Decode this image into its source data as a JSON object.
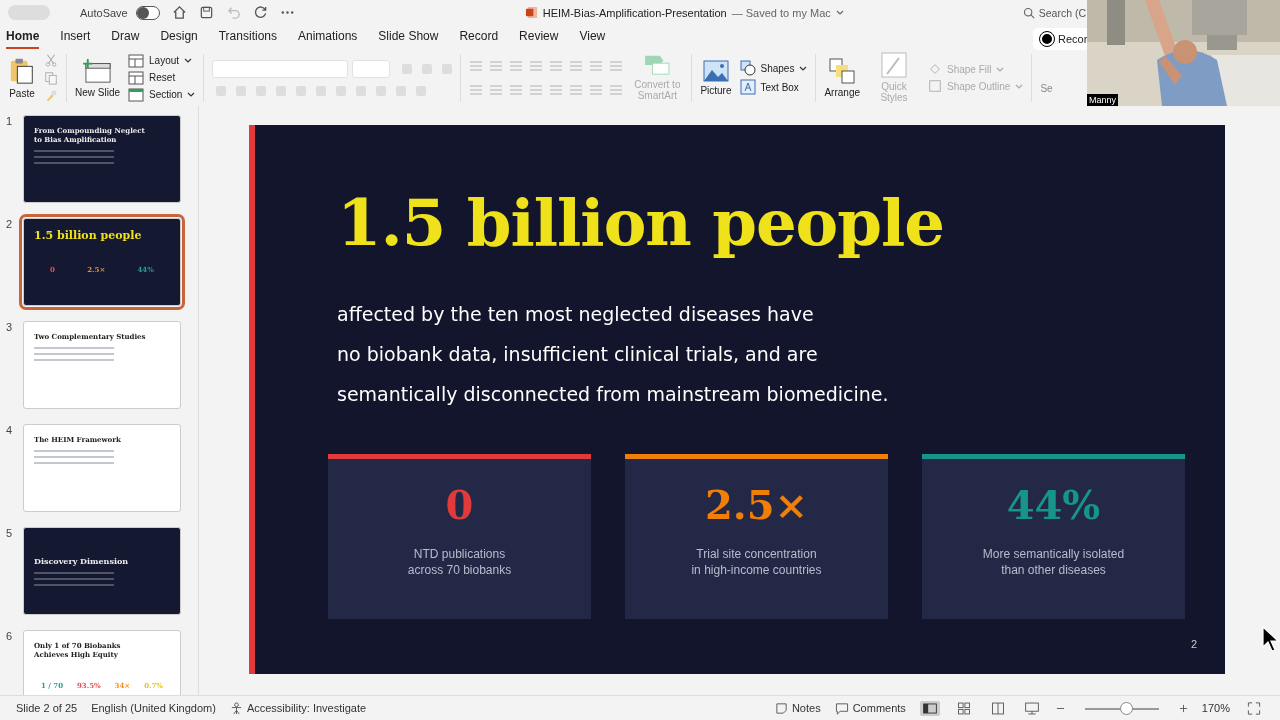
{
  "titlebar": {
    "autosave_label": "AutoSave",
    "autosave_on": false,
    "doc_title": "HEIM-Bias-Amplification-Presentation",
    "doc_status": "— Saved to my Mac",
    "search_placeholder": "Search (C"
  },
  "tabs": [
    {
      "label": "Home",
      "selected": true
    },
    {
      "label": "Insert",
      "selected": false
    },
    {
      "label": "Draw",
      "selected": false
    },
    {
      "label": "Design",
      "selected": false
    },
    {
      "label": "Transitions",
      "selected": false
    },
    {
      "label": "Animations",
      "selected": false
    },
    {
      "label": "Slide Show",
      "selected": false
    },
    {
      "label": "Record",
      "selected": false
    },
    {
      "label": "Review",
      "selected": false
    },
    {
      "label": "View",
      "selected": false
    }
  ],
  "record_button": "Recor",
  "ribbon": {
    "paste": "Paste",
    "new_slide": "New Slide",
    "slide_items": [
      "Layout",
      "Reset",
      "Section"
    ],
    "smartart": {
      "label": "Convert to SmartArt",
      "disabled": true
    },
    "picture": "Picture",
    "shapes": "Shapes",
    "text_box": "Text Box",
    "arrange": "Arrange",
    "quick_styles": {
      "label": "Quick Styles",
      "disabled": true
    },
    "shape_fill": {
      "label": "Shape Fill",
      "disabled": true
    },
    "shape_outline": {
      "label": "Shape Outline",
      "disabled": true
    },
    "cut_label": "Se"
  },
  "webcam": {
    "kind": "picture",
    "name": "Manny"
  },
  "thumbnails": [
    {
      "number": "1",
      "selected": false,
      "kind": "dark",
      "title": "From Compounding Neglect to Bias Amplification"
    },
    {
      "number": "2",
      "selected": true,
      "kind": "dark",
      "title": "1.5 billion people",
      "stats": [
        "0",
        "2.5×",
        "44%"
      ]
    },
    {
      "number": "3",
      "selected": false,
      "kind": "light",
      "title": "Two Complementary Studies"
    },
    {
      "number": "4",
      "selected": false,
      "kind": "light",
      "title": "The HEIM Framework"
    },
    {
      "number": "5",
      "selected": false,
      "kind": "dark",
      "title": "Discovery Dimension"
    },
    {
      "number": "6",
      "selected": false,
      "kind": "light",
      "title": "Only 1 of 70 Biobanks Achieves High Equity",
      "stats": [
        "1 / 70",
        "93.5%",
        "34×",
        "0.7%"
      ]
    }
  ],
  "slide": {
    "title": "1.5 billion people",
    "body_lines": [
      "affected by the ten most neglected diseases have",
      "no biobank data, insufficient clinical trials, and are",
      "semantically disconnected from mainstream biomedicine."
    ],
    "stats": [
      {
        "value": "0",
        "caption": [
          "NTD publications",
          "across 70 biobanks"
        ],
        "color": "#e03a3a"
      },
      {
        "value": "2.5×",
        "caption": [
          "Trial site concentration",
          "in high-income countries"
        ],
        "color": "#f07f0a"
      },
      {
        "value": "44%",
        "caption": [
          "More semantically isolated",
          "than other diseases"
        ],
        "color": "#16968a"
      }
    ],
    "page_number": "2"
  },
  "status_bar": {
    "slide_info": "Slide 2 of 25",
    "language": "English (United Kingdom)",
    "accessibility": "Accessibility: Investigate",
    "notes": "Notes",
    "comments": "Comments",
    "zoom_slider": {
      "level": 0.55
    },
    "zoom": "170%"
  }
}
